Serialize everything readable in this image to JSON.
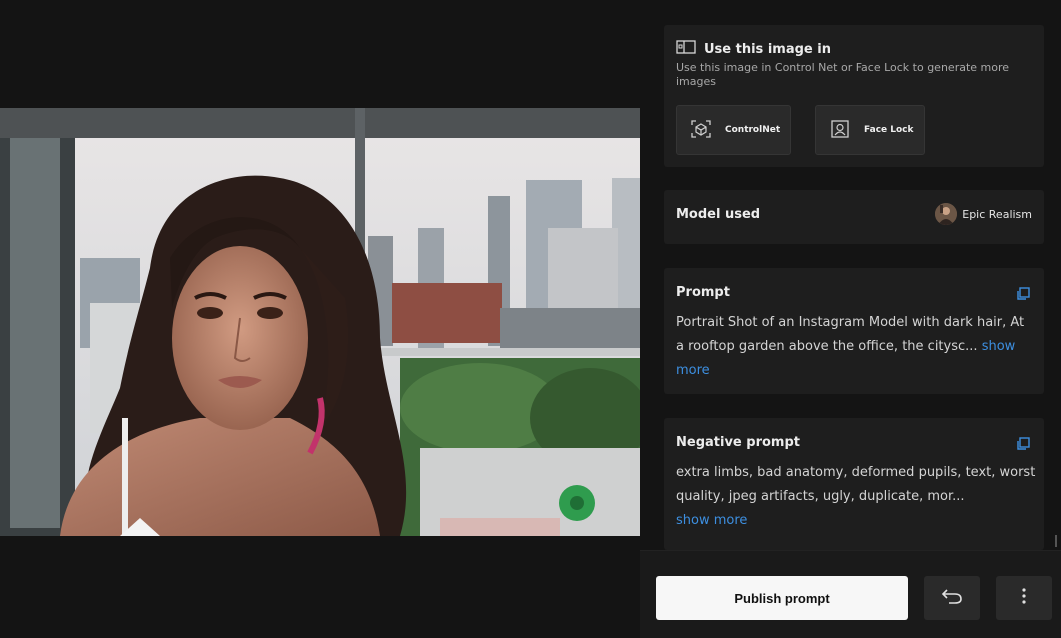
{
  "use_in": {
    "title": "Use this image in",
    "description": "Use this image in Control Net or Face Lock to generate more images",
    "buttons": [
      {
        "label": "ControlNet",
        "icon": "cube-scan-icon"
      },
      {
        "label": "Face Lock",
        "icon": "face-frame-icon"
      }
    ]
  },
  "model": {
    "label": "Model used",
    "name": "Epic Realism"
  },
  "prompt": {
    "title": "Prompt",
    "text": "Portrait Shot of an Instagram Model with dark hair, At a rooftop garden above the office, the citysc...",
    "show_more": "show more"
  },
  "negative_prompt": {
    "title": "Negative prompt",
    "text": "extra limbs, bad anatomy, deformed pupils, text, worst quality, jpeg artifacts, ugly, duplicate, mor...",
    "show_more": "show more"
  },
  "actions": {
    "publish_label": "Publish prompt"
  },
  "colors": {
    "background": "#131313",
    "card": "#1e1e1e",
    "link": "#3d8fe0",
    "publish_button": "#f7f7f7"
  }
}
